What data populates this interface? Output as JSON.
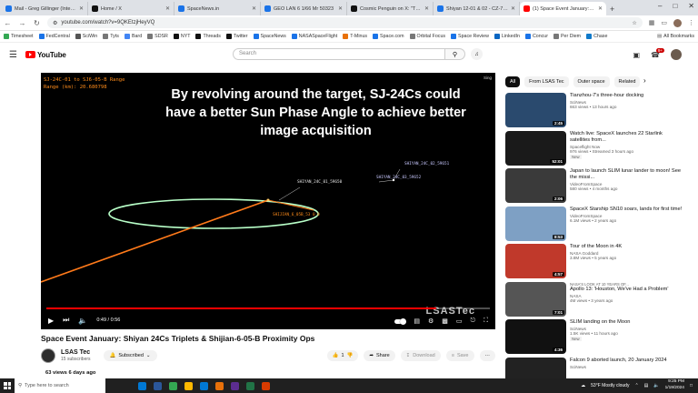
{
  "browser": {
    "tabs": [
      {
        "title": "Mail - Greg Gillinger (Integrity)",
        "color": "#1a73e8"
      },
      {
        "title": "Home / X",
        "color": "#111111"
      },
      {
        "title": "SpaceNews.in",
        "color": "#1a73e8"
      },
      {
        "title": "GEO LAN 6 1/66 Mr 50323",
        "color": "#1a73e8"
      },
      {
        "title": "Cosmic Penguin on X: \"The nu...",
        "color": "#111111"
      },
      {
        "title": "Shiyan 12-01 & 02 - CZ-7A - J...",
        "color": "#1a73e8"
      },
      {
        "title": "(1) Space Event January: Shiya...",
        "color": "#ff0000"
      }
    ],
    "new_tab": "+",
    "url": "youtube.com/watch?v=9QKEtzjHeyVQ",
    "bookmarks": [
      {
        "label": "Timesheet",
        "color": "#34a853"
      },
      {
        "label": "FedCentral",
        "color": "#1a73e8"
      },
      {
        "label": "SciWin",
        "color": "#555555"
      },
      {
        "label": "Tyts",
        "color": "#777777"
      },
      {
        "label": "Bard",
        "color": "#4285f4"
      },
      {
        "label": "SDSR",
        "color": "#777777"
      },
      {
        "label": "NYT",
        "color": "#111111"
      },
      {
        "label": "Threads",
        "color": "#111111"
      },
      {
        "label": "Twitter",
        "color": "#111111"
      },
      {
        "label": "SpaceNews",
        "color": "#1a73e8"
      },
      {
        "label": "NASASpaceFlight",
        "color": "#1a73e8"
      },
      {
        "label": "T-Minus",
        "color": "#e8710a"
      },
      {
        "label": "Space.com",
        "color": "#1a73e8"
      },
      {
        "label": "Orbital Focus",
        "color": "#777777"
      },
      {
        "label": "Space Review",
        "color": "#1a73e8"
      },
      {
        "label": "LinkedIn",
        "color": "#0a66c2"
      },
      {
        "label": "Concur",
        "color": "#1a73e8"
      },
      {
        "label": "Per Diem",
        "color": "#777777"
      },
      {
        "label": "Chase",
        "color": "#117aca"
      }
    ],
    "all_bookmarks": "All Bookmarks"
  },
  "youtube": {
    "logo": "YouTube",
    "search_placeholder": "Search",
    "notification_count": "9+"
  },
  "player": {
    "overlay_lines": [
      "SJ-24C-01 to SJ6-05-B Range",
      "Range (km): 20.680798"
    ],
    "headline": "By revolving around the target, SJ-24Cs could have a better Sun Phase Angle to achieve better image acquisition",
    "corner_label": "Sing",
    "labels": [
      {
        "text": "SHIYAN_24C_02_59651",
        "color": "#c8c8ff"
      },
      {
        "text": "SHIYAN_24C_01_59650",
        "color": "#e6e6e6"
      },
      {
        "text": "SHIYAN_24C_03_59652",
        "color": "#c8c8ff"
      },
      {
        "text": "SHIJIAN_6_05B_53 0 0",
        "color": "#ff8c1a"
      }
    ],
    "progress": 0.88,
    "time": "0:49 / 0:56",
    "watermark": "LSASTec"
  },
  "video": {
    "title": "Space Event January: Shiyan 24Cs Triplets & Shijian-6-05-B Proximity Ops",
    "channel": "LSAS Tec",
    "subscribers": "15 subscribers",
    "subscribe_label": "Subscribed",
    "likes": "1",
    "share": "Share",
    "download": "Download",
    "save": "Save",
    "meta": "63 views  6 days ago"
  },
  "sidebar": {
    "chips": [
      "All",
      "From LSAS Tec",
      "Outer space",
      "Related"
    ],
    "recommendations": [
      {
        "title": "Tianzhou-7's three-hour docking",
        "channel": "SciNews",
        "meta": "663 views • 13 hours ago",
        "duration": "2:45",
        "thumb": "#2a4a6e",
        "badge": ""
      },
      {
        "title": "Watch live: SpaceX launches 22 Starlink satellites from...",
        "channel": "Spaceflight Now",
        "meta": "976 views • Streamed 3 hours ago",
        "duration": "52:01",
        "thumb": "#1a1a1a",
        "badge": "New"
      },
      {
        "title": "Japan to launch SLIM lunar lander to moon! See the missi...",
        "channel": "VideoFromSpace",
        "meta": "580 views • 4 months ago",
        "duration": "2:06",
        "thumb": "#3a3a3a",
        "badge": ""
      },
      {
        "title": "SpaceX Starship SN10 soars, lands for first time!",
        "channel": "VideoFromSpace",
        "meta": "6.1M views • 2 years ago",
        "duration": "8:53",
        "thumb": "#7ea0c4",
        "badge": ""
      },
      {
        "title": "Tour of the Moon in 4K",
        "channel": "NASA Goddard",
        "meta": "3.8M views • 5 years ago",
        "duration": "4:57",
        "thumb": "#c0392b",
        "badge": ""
      },
      {
        "title": "Apollo 13: 'Houston, We've Had a Problem'",
        "channel": "NASA",
        "meta": "4M views • 3 years ago",
        "duration": "7:01",
        "thumb": "#555555",
        "badge": ""
      },
      {
        "title": "SLIM landing on the Moon",
        "channel": "SciNews",
        "meta": "1.5K views • 11 hours ago",
        "duration": "4:36",
        "thumb": "#111111",
        "badge": "New"
      },
      {
        "title": "Falcon 9 aborted launch, 20 January 2024",
        "channel": "SciNews",
        "meta": "",
        "duration": "",
        "thumb": "#222222",
        "badge": ""
      }
    ],
    "rec_top_note": "NASA'S LOOK AT 10 YEARS OF..."
  },
  "taskbar": {
    "search_placeholder": "Type here to search",
    "weather": "53°F  Mostly cloudy",
    "time": "9:25 PM",
    "date": "1/19/2024",
    "icons": [
      "#0078d4",
      "#2b579a",
      "#34a853",
      "#ffb900",
      "#0078d4",
      "#e8710a",
      "#5c2d91",
      "#217346",
      "#d83b01"
    ]
  }
}
